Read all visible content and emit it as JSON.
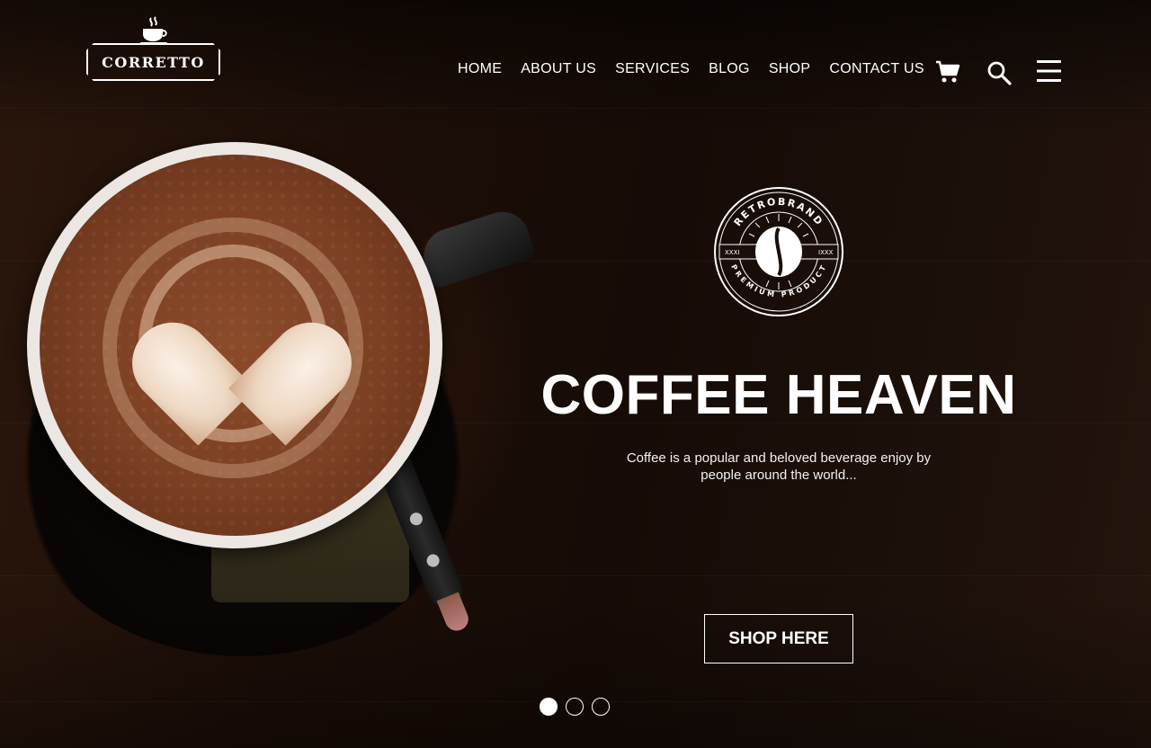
{
  "brand": {
    "name": "CORRETTO"
  },
  "nav": {
    "items": [
      {
        "label": "HOME"
      },
      {
        "label": "ABOUT US"
      },
      {
        "label": "SERVICES"
      },
      {
        "label": "BLOG"
      },
      {
        "label": "SHOP"
      },
      {
        "label": "CONTACT US"
      }
    ],
    "icons": [
      "cart-icon",
      "search-icon",
      "menu-icon"
    ]
  },
  "badge": {
    "top_text": "RETROBRAND",
    "bottom_text": "PREMIUM PRODUCT",
    "left_text": "XXXI",
    "right_text": "IXXX"
  },
  "hero": {
    "title": "COFFEE HEAVEN",
    "subtitle_line1": "Coffee is a popular and beloved beverage enjoy by",
    "subtitle_line2": "people around the world...",
    "cta_label": "SHOP HERE"
  },
  "slider": {
    "count": 3,
    "active_index": 0
  },
  "colors": {
    "background": "#1a0f0a",
    "text": "#ffffff",
    "foam": "#7b3f22"
  }
}
